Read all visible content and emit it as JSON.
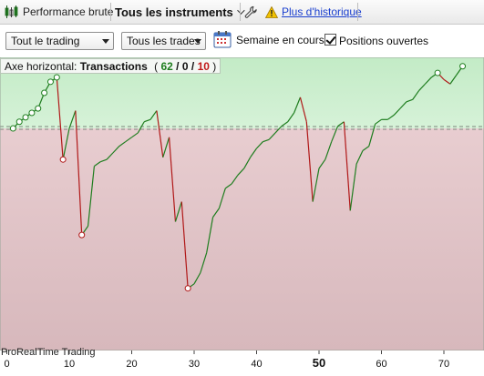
{
  "toolbar": {
    "performance_label": "Performance brute",
    "instruments_label": "Tous les instruments",
    "history_link": "Plus d'historique"
  },
  "filters": {
    "trading_select": "Tout le trading",
    "trades_select": "Tous les trades",
    "week_label": "Semaine en cours",
    "open_positions_label": "Positions ouvertes",
    "open_positions_checked": true
  },
  "axis_header": {
    "prefix": "Axe horizontal:",
    "mode": "Transactions",
    "open_paren": "(",
    "wins": "62",
    "sep1": "/",
    "even": "0",
    "sep2": "/",
    "losses": "10",
    "close_paren": ")"
  },
  "watermark": "ProRealTime Trading",
  "colors": {
    "gain_zone": "#c5ecc9",
    "loss_zone": "#e3c4c8",
    "gain_line": "#1e7d1e",
    "loss_line": "#b01818",
    "wins_text": "#1e7d1e",
    "losses_text": "#c01818"
  },
  "chart_data": {
    "type": "line",
    "xlabel": "",
    "ylabel": "",
    "xlim": [
      0,
      76
    ],
    "ylim": [
      -100,
      32
    ],
    "baseline": 0,
    "x_ticks": [
      "0",
      "10",
      "20",
      "30",
      "40",
      "50",
      "60",
      "70"
    ],
    "emphasized_tick": "50",
    "grid": false,
    "series": [
      {
        "values": [
          [
            1,
            0
          ],
          [
            2,
            3
          ],
          [
            3,
            5
          ],
          [
            4,
            7
          ],
          [
            5,
            9
          ],
          [
            6,
            16
          ],
          [
            7,
            21
          ],
          [
            8,
            23
          ],
          [
            9,
            -14
          ],
          [
            10,
            0
          ],
          [
            11,
            8
          ],
          [
            12,
            -48
          ],
          [
            13,
            -44
          ],
          [
            14,
            -17
          ],
          [
            15,
            -15
          ],
          [
            16,
            -14
          ],
          [
            17,
            -11
          ],
          [
            18,
            -8
          ],
          [
            19,
            -6
          ],
          [
            20,
            -4
          ],
          [
            21,
            -2
          ],
          [
            22,
            3
          ],
          [
            23,
            4
          ],
          [
            24,
            8
          ],
          [
            25,
            -13
          ],
          [
            26,
            -4
          ],
          [
            27,
            -42
          ],
          [
            28,
            -33
          ],
          [
            29,
            -72
          ],
          [
            30,
            -70
          ],
          [
            31,
            -65
          ],
          [
            32,
            -56
          ],
          [
            33,
            -40
          ],
          [
            34,
            -36
          ],
          [
            35,
            -27
          ],
          [
            36,
            -25
          ],
          [
            37,
            -21
          ],
          [
            38,
            -18
          ],
          [
            39,
            -13
          ],
          [
            40,
            -9
          ],
          [
            41,
            -6
          ],
          [
            42,
            -5
          ],
          [
            43,
            -2
          ],
          [
            44,
            1
          ],
          [
            45,
            3
          ],
          [
            46,
            7
          ],
          [
            47,
            14
          ],
          [
            48,
            3
          ],
          [
            49,
            -33
          ],
          [
            50,
            -18
          ],
          [
            51,
            -14
          ],
          [
            52,
            -6
          ],
          [
            53,
            1
          ],
          [
            54,
            3
          ],
          [
            55,
            -37
          ],
          [
            56,
            -16
          ],
          [
            57,
            -10
          ],
          [
            58,
            -8
          ],
          [
            59,
            2
          ],
          [
            60,
            4
          ],
          [
            61,
            4
          ],
          [
            62,
            6
          ],
          [
            63,
            9
          ],
          [
            64,
            12
          ],
          [
            65,
            13
          ],
          [
            66,
            17
          ],
          [
            67,
            20
          ],
          [
            68,
            23
          ],
          [
            69,
            25
          ],
          [
            70,
            22
          ],
          [
            71,
            20
          ],
          [
            72,
            24
          ],
          [
            73,
            28
          ]
        ],
        "circled_x": [
          1,
          2,
          3,
          4,
          5,
          6,
          7,
          8,
          9,
          12,
          29,
          69,
          73
        ]
      }
    ]
  }
}
